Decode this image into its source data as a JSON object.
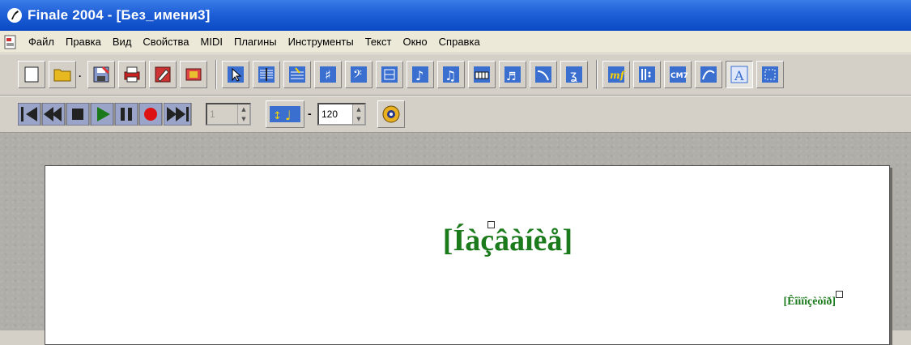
{
  "window": {
    "title": "Finale 2004 - [Без_имени3]"
  },
  "menu": {
    "items": [
      "Файл",
      "Правка",
      "Вид",
      "Свойства",
      "MIDI",
      "Плагины",
      "Инструменты",
      "Текст",
      "Окно",
      "Справка"
    ]
  },
  "toolbar_playback": {
    "measure_value": "1",
    "tempo_value": "120"
  },
  "score": {
    "title": "[Íàçâàíèå]",
    "composer": "[Êîìïîçèòîð]"
  },
  "colors": {
    "titlebar": "#0a49c4",
    "score_text": "#1b7a1b",
    "chrome": "#d4d0c8"
  }
}
